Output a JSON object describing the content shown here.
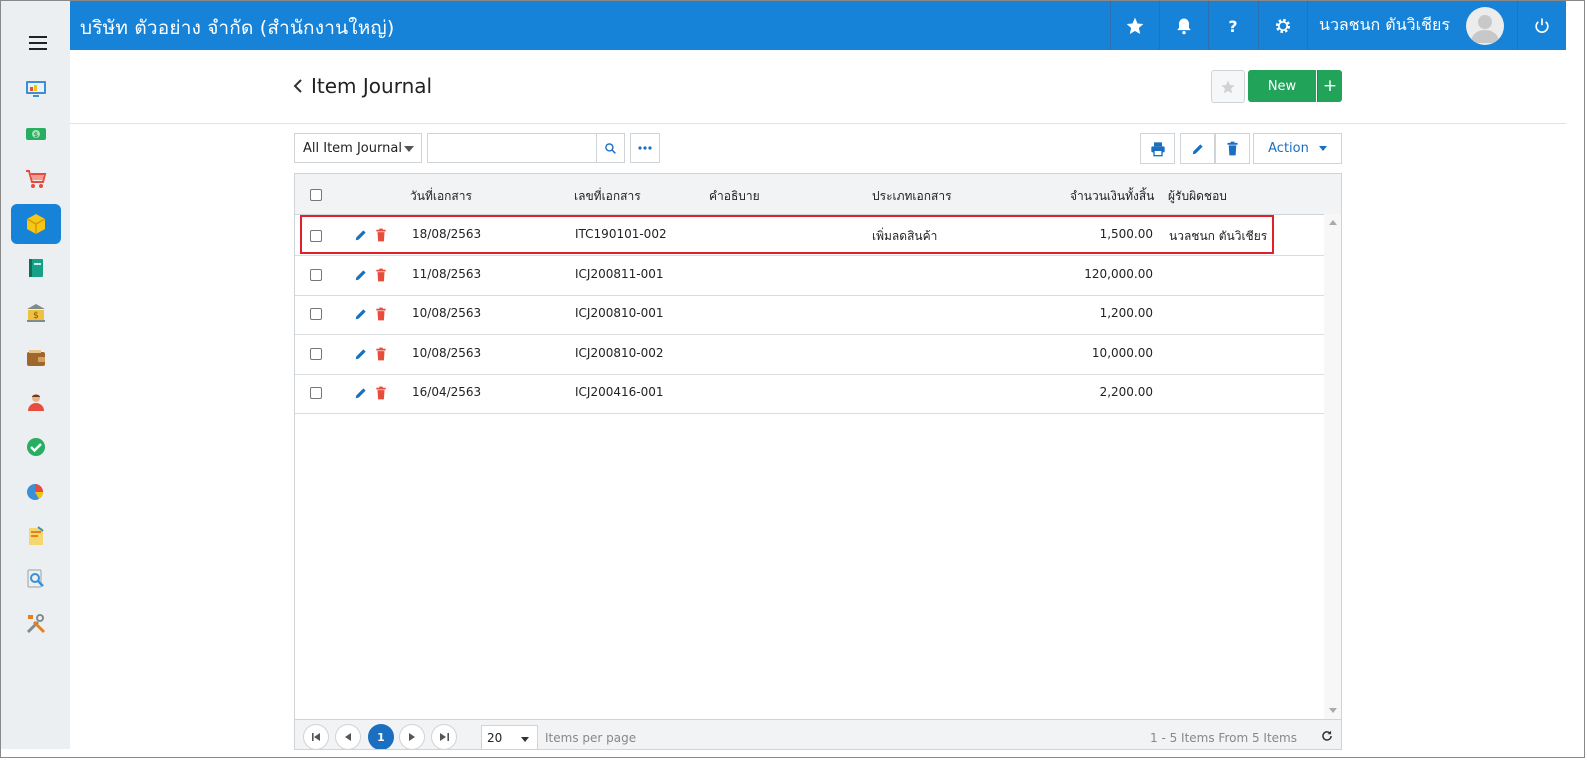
{
  "topbar": {
    "company": "บริษัท ตัวอย่าง จำกัด (สำนักงานใหญ่)",
    "user_name": "นวลชนก ตันวิเชียร",
    "accent": "#1683d9"
  },
  "sidebar": {
    "items": [
      {
        "icon": "dashboard-icon"
      },
      {
        "icon": "money-icon"
      },
      {
        "icon": "cart-icon"
      },
      {
        "icon": "inventory-box-icon",
        "active": true
      },
      {
        "icon": "book-icon"
      },
      {
        "icon": "bank-icon"
      },
      {
        "icon": "wallet-icon"
      },
      {
        "icon": "people-icon"
      },
      {
        "icon": "check-circle-icon"
      },
      {
        "icon": "pie-chart-icon"
      },
      {
        "icon": "report-icon"
      },
      {
        "icon": "search-doc-icon"
      },
      {
        "icon": "tools-icon"
      }
    ]
  },
  "header": {
    "title": "Item Journal",
    "new_label": "New",
    "plus_label": "+"
  },
  "toolbar": {
    "filter_value": "All Item Journal",
    "search_placeholder": "",
    "action_label": "Action"
  },
  "table": {
    "columns": {
      "date": "วันที่เอกสาร",
      "doc_no": "เลขที่เอกสาร",
      "description": "คำอธิบาย",
      "doc_type": "ประเภทเอกสาร",
      "total": "จำนวนเงินทั้งสิ้น",
      "owner": "ผู้รับผิดชอบ"
    },
    "rows": [
      {
        "date": "18/08/2563",
        "doc_no": "ITC190101-002",
        "description": "",
        "doc_type": "เพิ่มลดสินค้า",
        "total": "1,500.00",
        "owner": "นวลชนก ตันวิเชียร"
      },
      {
        "date": "11/08/2563",
        "doc_no": "ICJ200811-001",
        "description": "",
        "doc_type": "",
        "total": "120,000.00",
        "owner": ""
      },
      {
        "date": "10/08/2563",
        "doc_no": "ICJ200810-001",
        "description": "",
        "doc_type": "",
        "total": "1,200.00",
        "owner": ""
      },
      {
        "date": "10/08/2563",
        "doc_no": "ICJ200810-002",
        "description": "",
        "doc_type": "",
        "total": "10,000.00",
        "owner": ""
      },
      {
        "date": "16/04/2563",
        "doc_no": "ICJ200416-001",
        "description": "",
        "doc_type": "",
        "total": "2,200.00",
        "owner": ""
      }
    ]
  },
  "pager": {
    "current_page": "1",
    "per_page": "20",
    "per_page_label": "Items per page",
    "summary": "1 - 5 Items From 5 Items"
  }
}
